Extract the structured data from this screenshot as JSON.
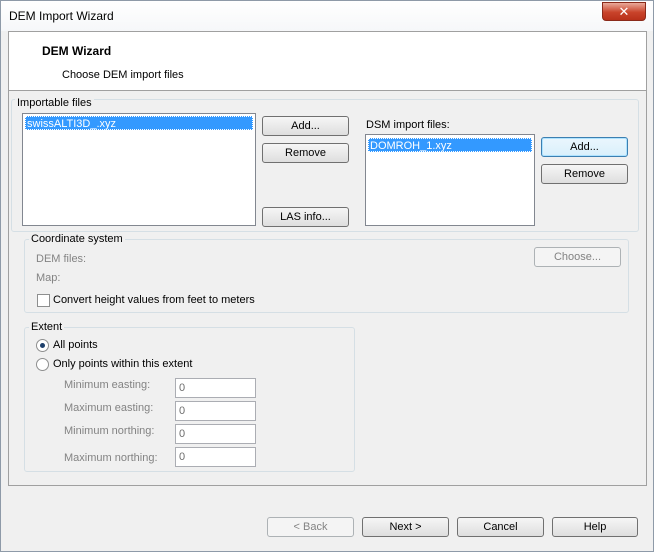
{
  "window": {
    "title": "DEM Import Wizard",
    "close_glyph": "✕"
  },
  "header": {
    "title": "DEM Wizard",
    "subtitle": "Choose DEM import files"
  },
  "importable": {
    "group_label": "Importable files",
    "files": [
      "swissALTI3D_.xyz"
    ],
    "add_label": "Add...",
    "remove_label": "Remove",
    "las_info_label": "LAS info..."
  },
  "dsm": {
    "label": "DSM import files:",
    "files": [
      "DOMROH_1.xyz"
    ],
    "add_label": "Add...",
    "remove_label": "Remove"
  },
  "coordinate_system": {
    "group_label": "Coordinate system",
    "dem_files_label": "DEM files:",
    "map_label": "Map:",
    "choose_label": "Choose...",
    "convert_label": "Convert height values from feet to meters",
    "convert_checked": false
  },
  "extent": {
    "group_label": "Extent",
    "all_points_label": "All points",
    "within_extent_label": "Only points within this extent",
    "selected": "all_points",
    "min_easting_label": "Minimum easting:",
    "min_easting_value": "0",
    "max_easting_label": "Maximum easting:",
    "max_easting_value": "0",
    "min_northing_label": "Minimum northing:",
    "min_northing_value": "0",
    "max_northing_label": "Maximum northing:",
    "max_northing_value": "0"
  },
  "footer": {
    "back_label": "< Back",
    "next_label": "Next >",
    "cancel_label": "Cancel",
    "help_label": "Help"
  }
}
